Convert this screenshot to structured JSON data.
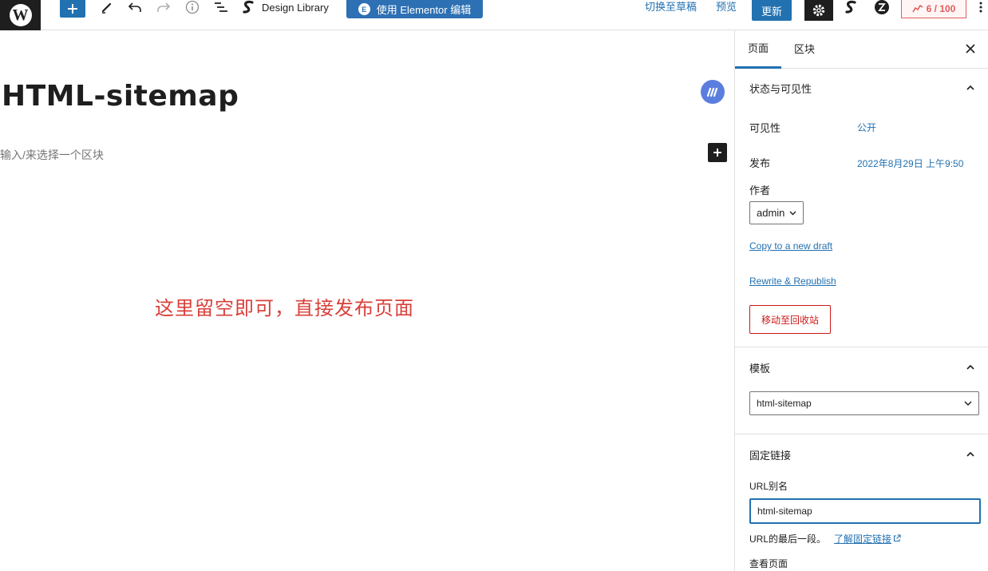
{
  "toolbar": {
    "wp_logo": "W",
    "design_library": "Design Library",
    "elementor_button": "使用 Elementor 编辑",
    "switch_to_draft": "切换至草稿",
    "preview": "预览",
    "update": "更新",
    "score": "6 / 100",
    "accent_color": "#2271b1"
  },
  "editor": {
    "title": "HTML-sitemap",
    "block_placeholder": "输入/来选择一个区块",
    "annotation": "这里留空即可，直接发布页面",
    "annotation_color": "#d9403a"
  },
  "sidebar": {
    "tabs": [
      {
        "label": "页面",
        "active": true
      },
      {
        "label": "区块",
        "active": false
      }
    ],
    "status_panel": {
      "title": "状态与可见性",
      "visibility_label": "可见性",
      "visibility_value": "公开",
      "publish_label": "发布",
      "publish_value": "2022年8月29日 上午9:50",
      "author_label": "作者",
      "author_value": "admin",
      "copy_draft": "Copy to a new draft",
      "rewrite": "Rewrite & Republish",
      "trash": "移动至回收站"
    },
    "template_panel": {
      "title": "模板",
      "template_value": "html-sitemap"
    },
    "permalink_panel": {
      "title": "固定链接",
      "slug_label": "URL别名",
      "slug_value": "html-sitemap",
      "help_text": "URL的最后一段。",
      "help_link": "了解固定链接",
      "view_page": "查看页面"
    }
  }
}
